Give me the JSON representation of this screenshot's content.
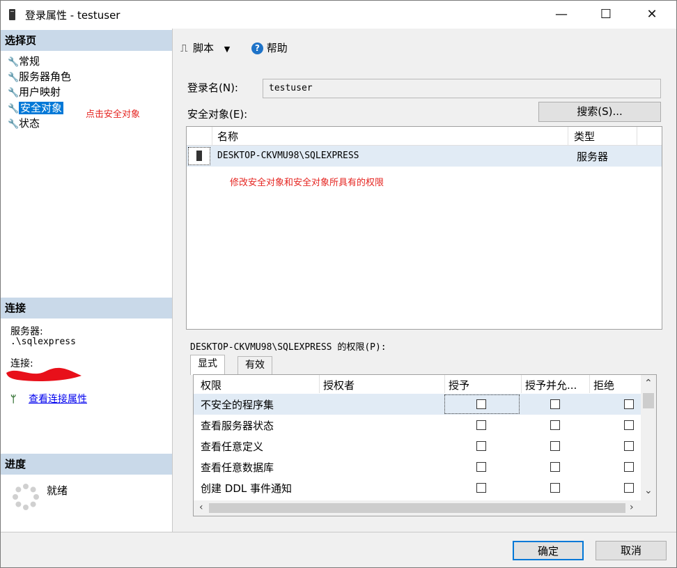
{
  "window": {
    "title": "登录属性 - testuser",
    "min": "—",
    "max": "☐",
    "close": "✕"
  },
  "left": {
    "select_page_header": "选择页",
    "pages": [
      {
        "label": "常规"
      },
      {
        "label": "服务器角色"
      },
      {
        "label": "用户映射"
      },
      {
        "label": "安全对象"
      },
      {
        "label": "状态"
      }
    ],
    "annotation_click": "点击安全对象",
    "connection_header": "连接",
    "server_label": "服务器:",
    "server_value": ".\\sqlexpress",
    "connection_label": "连接:",
    "view_connection_link": "查看连接属性",
    "progress_header": "进度",
    "progress_status": "就绪"
  },
  "toolbar": {
    "script_label": "脚本",
    "help_label": "帮助"
  },
  "main": {
    "login_label": "登录名(N):",
    "login_value": "testuser",
    "securables_label": "安全对象(E):",
    "search_button": "搜索(S)...",
    "securables_columns": [
      "名称",
      "类型"
    ],
    "securables_rows": [
      {
        "name": "DESKTOP-CKVMU98\\SQLEXPRESS",
        "type": "服务器"
      }
    ],
    "annotation_modify": "修改安全对象和安全对象所具有的权限",
    "permissions_label": "DESKTOP-CKVMU98\\SQLEXPRESS 的权限(P):",
    "tabs": [
      "显式",
      "有效"
    ],
    "perm_columns": [
      "权限",
      "授权者",
      "授予",
      "授予并允...",
      "拒绝"
    ],
    "perm_rows": [
      {
        "permission": "不安全的程序集",
        "grantor": "",
        "grant": false,
        "with_grant": false,
        "deny": false
      },
      {
        "permission": "查看服务器状态",
        "grantor": "",
        "grant": false,
        "with_grant": false,
        "deny": false
      },
      {
        "permission": "查看任意定义",
        "grantor": "",
        "grant": false,
        "with_grant": false,
        "deny": false
      },
      {
        "permission": "查看任意数据库",
        "grantor": "",
        "grant": false,
        "with_grant": false,
        "deny": false
      },
      {
        "permission": "创建 DDL 事件通知",
        "grantor": "",
        "grant": false,
        "with_grant": false,
        "deny": false
      }
    ]
  },
  "footer": {
    "ok_button": "确定",
    "cancel_button": "取消"
  },
  "colors": {
    "section_header": "#c9d9e9",
    "selection": "#0078d7",
    "annotation": "#e52521",
    "link": "#0000ee",
    "row_highlight": "#e1ebf5"
  }
}
